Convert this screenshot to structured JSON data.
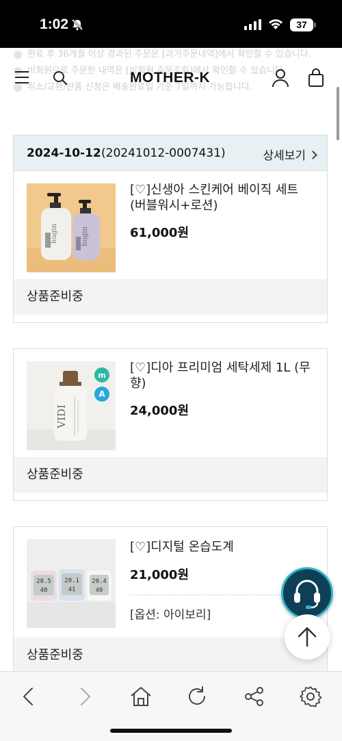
{
  "status_bar": {
    "time": "1:02",
    "battery": "37"
  },
  "notices": [
    "완료 후 36개월 이상 경과된 주문은 [과거주문내역]에서 확인할 수 있습니다.",
    "비회원으로 주문한 내역은 [비회원 주문조회]에서 확인할 수 있습니다.",
    "취소/교환/반품 신청은 배송완료일 기준 7일까지 가능합니다."
  ],
  "header": {
    "logo": "MOTHER-K"
  },
  "order": {
    "date": "2024-10-12",
    "number": "(20241012-0007431)",
    "detail_label": "상세보기"
  },
  "items": [
    {
      "title": "[♡]신생아 스킨케어 베이직 세트 (버블워시+로션)",
      "price": "61,000원",
      "status": "상품준비중"
    },
    {
      "title": "[♡]디아 프리미엄 세탁세제 1L (무향)",
      "price": "24,000원",
      "status": "상품준비중"
    },
    {
      "title": "[♡]디지털 온습도계",
      "price": "21,000원",
      "option": "[옵션: 아이보리]",
      "status": "상품준비중"
    }
  ],
  "product_images": {
    "item1_brand": "hugin",
    "item2_brand": "VIDI",
    "item2_badges": [
      "m",
      "A"
    ],
    "item3_readings": [
      {
        "temp": "20.5",
        "hum": "40"
      },
      {
        "temp": "20.1",
        "hum": "41"
      },
      {
        "temp": "20.4",
        "hum": "40"
      }
    ]
  },
  "colors": {
    "order_header_bg": "#e7f0f3",
    "status_bg": "#f3f3f3",
    "support_fab": "#0f3f57",
    "accent_teal": "#2fb8c9"
  }
}
